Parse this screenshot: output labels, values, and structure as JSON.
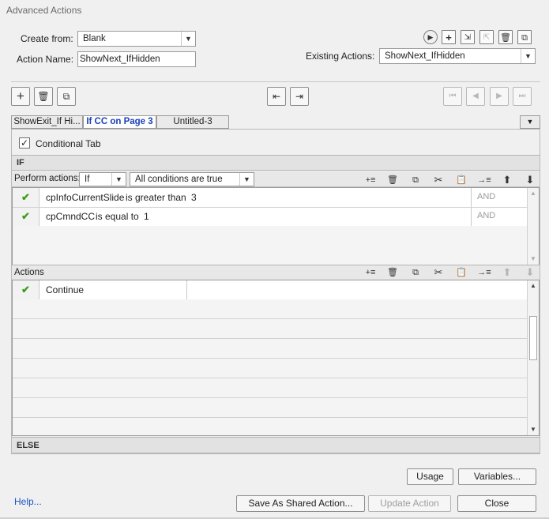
{
  "window": {
    "title": "Advanced Actions"
  },
  "create_from": {
    "label": "Create from:",
    "value": "Blank"
  },
  "action_name": {
    "label": "Action Name:",
    "value": "ShowNext_IfHidden"
  },
  "existing_actions": {
    "label": "Existing Actions:",
    "value": "ShowNext_IfHidden"
  },
  "tabs": [
    {
      "label": "ShowExit_If Hi..."
    },
    {
      "label": "If CC on Page 3"
    },
    {
      "label": "Untitled-3"
    }
  ],
  "conditional_tab": {
    "label": "Conditional Tab",
    "checked": true
  },
  "if_section": {
    "label": "IF"
  },
  "perform_actions": {
    "label": "Perform actions:",
    "mode": "If",
    "condition_mode": "All conditions are true"
  },
  "conditions": [
    {
      "variable": "cpInfoCurrentSlide",
      "operator": "is greater than",
      "value": "3",
      "logic": "AND"
    },
    {
      "variable": "cpCmndCC",
      "operator": "is equal to",
      "value": "1",
      "logic": "AND"
    }
  ],
  "actions_section": {
    "label": "Actions"
  },
  "actions": [
    {
      "label": "Continue"
    }
  ],
  "else_section": {
    "label": "ELSE"
  },
  "buttons": {
    "usage": "Usage",
    "variables": "Variables...",
    "help": "Help...",
    "save_shared": "Save As Shared Action...",
    "update": "Update Action",
    "close": "Close"
  },
  "colors": {
    "accent_tab": "#1a3fb8",
    "check": "#3aa01c",
    "link": "#1a55c8"
  }
}
